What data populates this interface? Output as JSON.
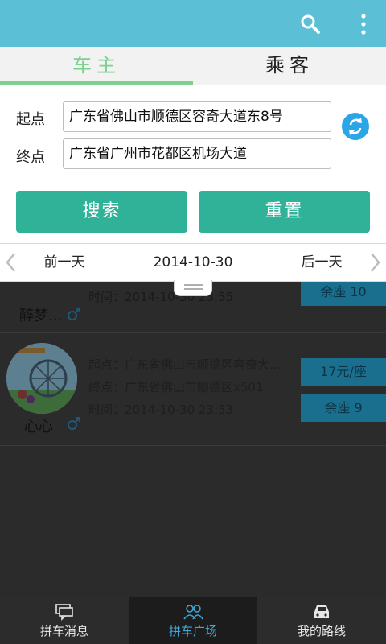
{
  "tabs": [
    {
      "label": "车主",
      "active": true
    },
    {
      "label": "乘客",
      "active": false
    }
  ],
  "form": {
    "start_label": "起点",
    "start_value": "广东省佛山市顺德区容奇大道东8号",
    "end_label": "终点",
    "end_value": "广东省广州市花都区机场大道",
    "search_button": "搜索",
    "reset_button": "重置"
  },
  "datebar": {
    "prev_label": "前一天",
    "current_date": "2014-10-30",
    "next_label": "后一天"
  },
  "list": [
    {
      "name": "醉梦…",
      "time_partial": "时间：2014-10-30 23:55",
      "seats_partial": "余座 10"
    },
    {
      "name": "心心",
      "start": "起点：广东省佛山市顺德区容奇大...",
      "end": "终点：广东省佛山市顺德区x501",
      "time": "时间：2014-10-30 23:53",
      "price": "17元/座",
      "seats": "余座 9"
    }
  ],
  "bottom_nav": [
    {
      "label": "拼车消息",
      "icon": "chat-icon",
      "active": false
    },
    {
      "label": "拼车广场",
      "icon": "people-icon",
      "active": true
    },
    {
      "label": "我的路线",
      "icon": "car-icon",
      "active": false
    }
  ],
  "colors": {
    "appbar": "#5bc0d6",
    "tab_active": "#7dd08e",
    "button": "#2fb298",
    "swap_icon": "#2aa6e8",
    "nav_active": "#41a6d8"
  }
}
